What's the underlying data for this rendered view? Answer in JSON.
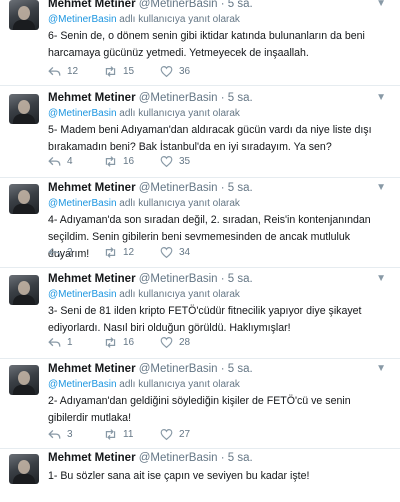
{
  "tweets": [
    {
      "name": "Mehmet Metiner",
      "handle": "@MetinerBasin",
      "sep": "·",
      "time": "5 sa.",
      "reply_mention": "@MetinerBasin",
      "reply_suffix": " adlı kullanıcıya yanıt olarak",
      "text": "6- Senin de, o dönem senin gibi iktidar katında bulunanların da beni harcamaya gücünüz yetmedi. Yetmeyecek de inşaallah.",
      "replies": "12",
      "retweets": "15",
      "likes": "36"
    },
    {
      "name": "Mehmet Metiner",
      "handle": "@MetinerBasin",
      "sep": "·",
      "time": "5 sa.",
      "reply_mention": "@MetinerBasin",
      "reply_suffix": " adlı kullanıcıya yanıt olarak",
      "text": "5- Madem beni Adıyaman'dan aldıracak gücün vardı da niye liste dışı bırakamadın beni? Bak İstanbul'da en iyi sıradayım. Ya sen?",
      "replies": "4",
      "retweets": "16",
      "likes": "35"
    },
    {
      "name": "Mehmet Metiner",
      "handle": "@MetinerBasin",
      "sep": "·",
      "time": "5 sa.",
      "reply_mention": "@MetinerBasin",
      "reply_suffix": " adlı kullanıcıya yanıt olarak",
      "text": "4- Adıyaman'da son sıradan değil, 2. sıradan, Reis'in kontenjanından seçildim. Senin gibilerin beni sevmemesinden de ancak mutluluk duyarım!",
      "replies": "2",
      "retweets": "12",
      "likes": "34"
    },
    {
      "name": "Mehmet Metiner",
      "handle": "@MetinerBasin",
      "sep": "·",
      "time": "5 sa.",
      "reply_mention": "@MetinerBasin",
      "reply_suffix": " adlı kullanıcıya yanıt olarak",
      "text": "3- Seni de 81 ilden kripto FETÖ'cüdür fitnecilik yapıyor diye şikayet ediyorlardı. Nasıl biri olduğun görüldü. Haklıymışlar!",
      "replies": "1",
      "retweets": "16",
      "likes": "28"
    },
    {
      "name": "Mehmet Metiner",
      "handle": "@MetinerBasin",
      "sep": "·",
      "time": "5 sa.",
      "reply_mention": "@MetinerBasin",
      "reply_suffix": " adlı kullanıcıya yanıt olarak",
      "text": "2- Adıyaman'dan geldiğini söylediğin kişiler de FETÖ'cü ve senin gibilerdir mutlaka!",
      "replies": "3",
      "retweets": "11",
      "likes": "27"
    },
    {
      "name": "Mehmet Metiner",
      "handle": "@MetinerBasin",
      "sep": "·",
      "time": "5 sa.",
      "text": "1- Bu sözler sana ait ise çapın ve seviyen bu kadar işte!"
    }
  ],
  "icons": {
    "chevron": "chevron-down-icon",
    "reply": "reply-icon",
    "retweet": "retweet-icon",
    "like": "heart-icon"
  },
  "colors": {
    "link": "#1b95e0",
    "muted": "#657786",
    "text": "#14171a",
    "divider": "#e6ecf0"
  }
}
